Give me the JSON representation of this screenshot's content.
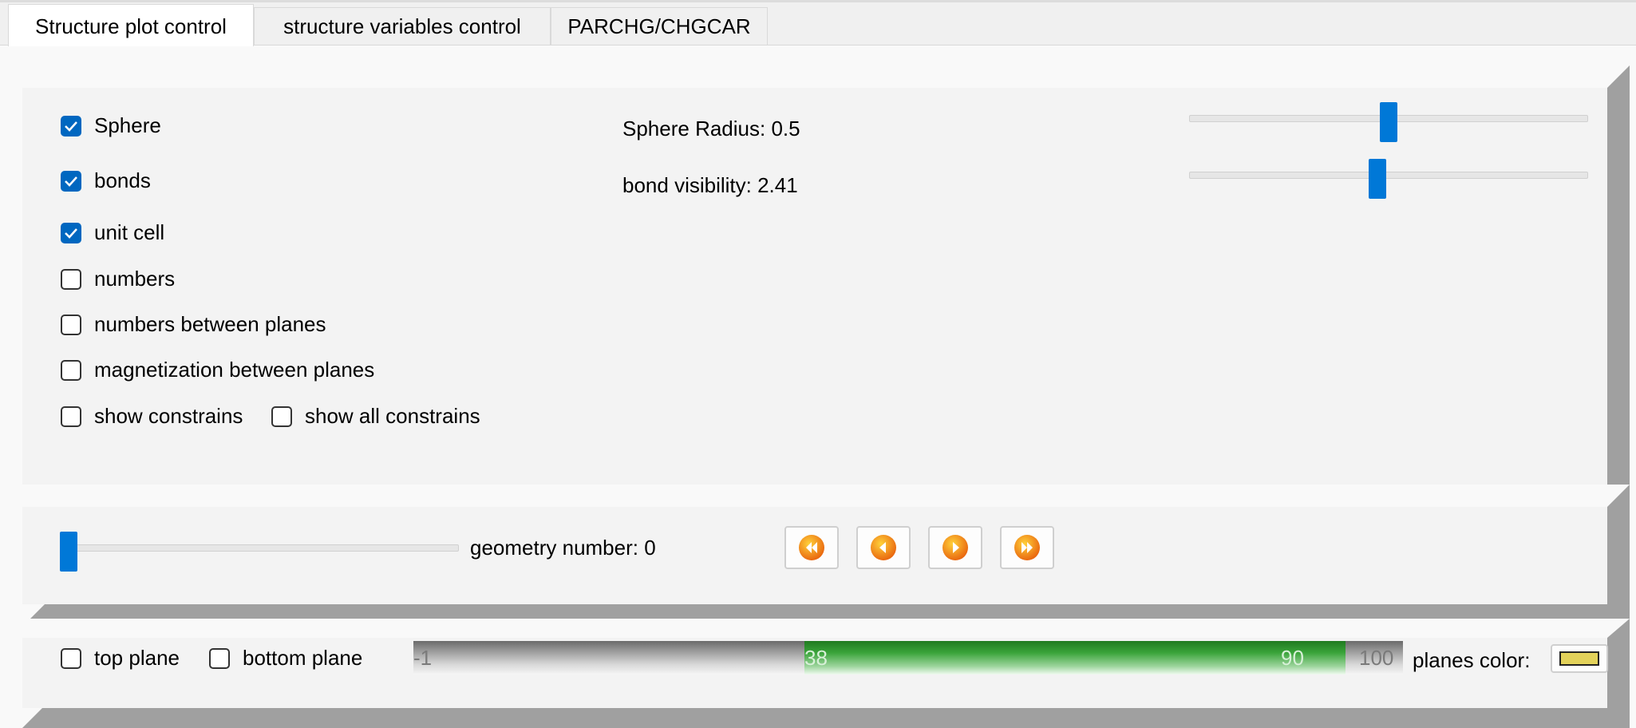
{
  "tabs": [
    {
      "label": "Structure plot control"
    },
    {
      "label": "structure variables control"
    },
    {
      "label": "PARCHG/CHGCAR"
    }
  ],
  "display": {
    "checkboxes": {
      "sphere": {
        "label": "Sphere",
        "checked": true
      },
      "bonds": {
        "label": "bonds",
        "checked": true
      },
      "unit_cell": {
        "label": "unit cell",
        "checked": true
      },
      "numbers": {
        "label": "numbers",
        "checked": false
      },
      "numbers_between_planes": {
        "label": "numbers between planes",
        "checked": false
      },
      "magnetization_between_planes": {
        "label": "magnetization between planes",
        "checked": false
      },
      "show_constrains": {
        "label": "show constrains",
        "checked": false
      },
      "show_all_constrains": {
        "label": "show all constrains",
        "checked": false
      }
    },
    "sphere_radius_label": "Sphere Radius: 0.5",
    "sphere_radius_slider_fraction": 0.5,
    "bond_visibility_label": "bond visibility: 2.41",
    "bond_visibility_slider_fraction": 0.47
  },
  "geometry": {
    "label": "geometry number: 0",
    "slider_fraction": 0.0,
    "buttons": [
      "first-icon",
      "previous-icon",
      "next-icon",
      "last-icon"
    ]
  },
  "planes": {
    "top_plane": {
      "label": "top plane",
      "checked": false
    },
    "bottom_plane": {
      "label": "bottom plane",
      "checked": false
    },
    "range": {
      "min": "-1",
      "low": "38",
      "high": "90",
      "max": "100"
    },
    "color_label": "planes color:",
    "color": "#e3d25a"
  },
  "colors": {
    "accent": "#0078d7",
    "checkbox_checked": "#0067c0",
    "nav_button_orange": "#f08a1c",
    "range_selected": "#3aa43a"
  }
}
